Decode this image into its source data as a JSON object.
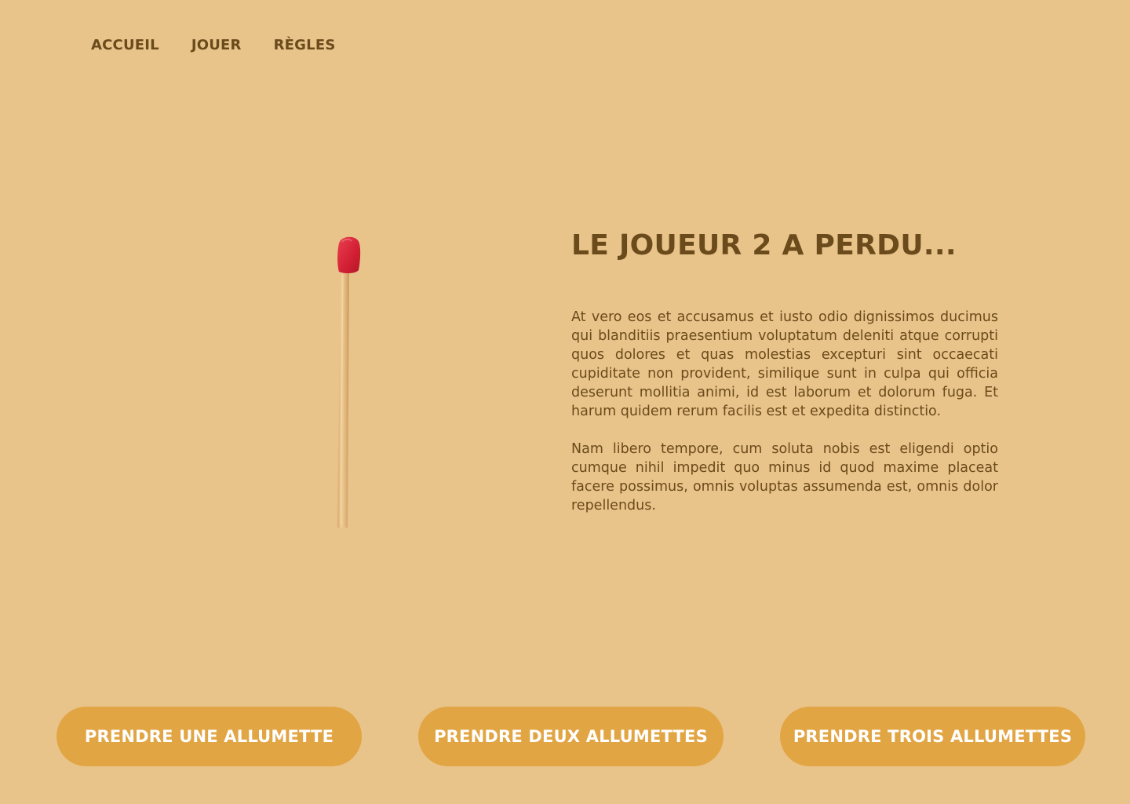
{
  "nav": {
    "items": [
      {
        "label": "ACCUEIL"
      },
      {
        "label": "JOUER"
      },
      {
        "label": "RÈGLES"
      }
    ]
  },
  "game": {
    "remaining_matches_shown": 1,
    "match_head_color": "#d8263a",
    "match_stick_color": "#e3b77c"
  },
  "result": {
    "title": "LE JOUEUR 2 A PERDU...",
    "paragraphs": [
      "At vero eos et accusamus et iusto odio dignissimos ducimus qui blanditiis praesentium voluptatum deleniti atque corrupti quos dolores et quas molestias excepturi sint occaecati cupiditate non provident, similique sunt in culpa qui officia deserunt mollitia animi, id est laborum et dolorum fuga. Et harum quidem rerum facilis est et expedita distinctio.",
      "Nam libero tempore, cum soluta nobis est eligendi optio cumque nihil impedit quo minus id quod maxime placeat facere possimus, omnis voluptas assumenda est, omnis dolor repellendus."
    ]
  },
  "actions": {
    "take_one": "PRENDRE UNE ALLUMETTE",
    "take_two": "PRENDRE DEUX ALLUMETTES",
    "take_three": "PRENDRE TROIS ALLUMETTES"
  },
  "colors": {
    "background": "#e8c48a",
    "text": "#6b4a1b",
    "button": "#e2a544",
    "button_text": "#ffffff"
  }
}
